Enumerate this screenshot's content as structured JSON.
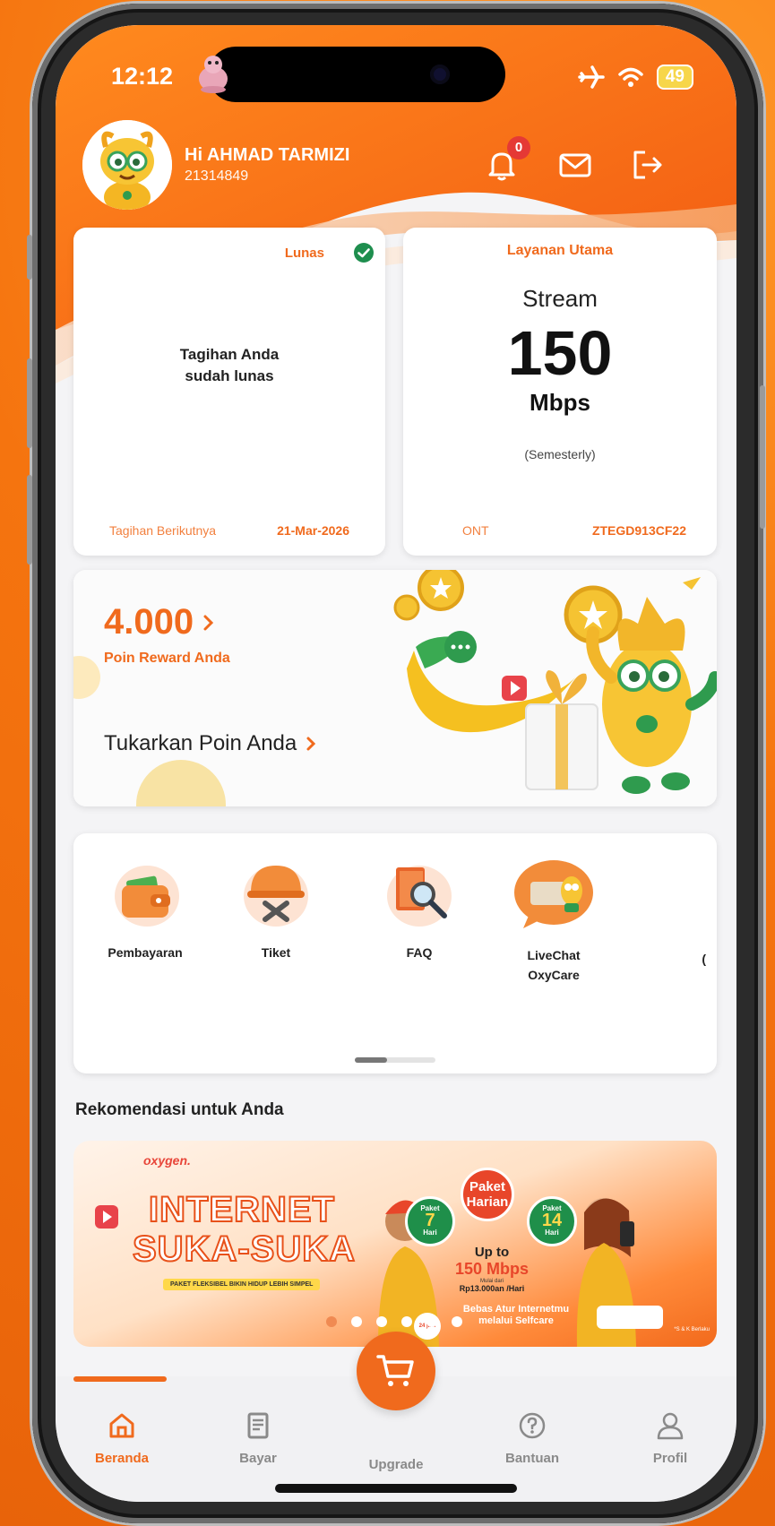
{
  "status": {
    "time": "12:12",
    "battery": "49"
  },
  "user": {
    "greeting": "Hi AHMAD TARMIZI",
    "id": "21314849"
  },
  "notifications": {
    "count": "0"
  },
  "bill_card": {
    "status": "Lunas",
    "message_line1": "Tagihan Anda",
    "message_line2": "sudah lunas",
    "next_label": "Tagihan Berikutnya",
    "next_date": "21-Mar-2026"
  },
  "service_card": {
    "title": "Layanan Utama",
    "plan": "Stream",
    "speed": "150",
    "unit": "Mbps",
    "period": "(Semesterly)",
    "ont_label": "ONT",
    "ont_id": "ZTEGD913CF22"
  },
  "reward_card": {
    "points": "4.000",
    "points_label": "Poin Reward Anda",
    "redeem": "Tukarkan Poin Anda"
  },
  "menu": {
    "items": [
      {
        "label": "Pembayaran",
        "icon": "wallet-icon"
      },
      {
        "label": "Tiket",
        "icon": "helmet-tools-icon"
      },
      {
        "label": "FAQ",
        "icon": "book-search-icon"
      },
      {
        "label": "LiveChat OxyCare",
        "icon": "livechat-icon"
      }
    ],
    "cut_off_label": "("
  },
  "recommend": {
    "title": "Rekomendasi untuk Anda"
  },
  "banner": {
    "brand": "oxygen.",
    "headline1": "INTERNET",
    "headline2": "SUKA-SUKA",
    "tagline": "PAKET FLEKSIBEL BIKIN HIDUP LEBIH SIMPEL",
    "badge_left_top": "Paket",
    "badge_left_num": "7",
    "badge_left_bottom": "Hari",
    "badge_center": "Paket Harian",
    "badge_right_top": "Paket",
    "badge_right_num": "14",
    "badge_right_bottom": "Hari",
    "upto": "Up to",
    "speed": "150 Mbps",
    "price_note": "Mulai dari",
    "price": "Rp13.000an /Hari",
    "cta": "Bebas Atur Internetmu melalui Selfcare",
    "small_tag": "24 jam",
    "tnc": "*S & K Berlaku"
  },
  "nav": {
    "home": "Beranda",
    "pay": "Bayar",
    "upgrade": "Upgrade",
    "help": "Bantuan",
    "profile": "Profil"
  },
  "colors": {
    "accent": "#f06a1d",
    "success": "#1e8e4e",
    "active_nav": "#f06a1d"
  }
}
